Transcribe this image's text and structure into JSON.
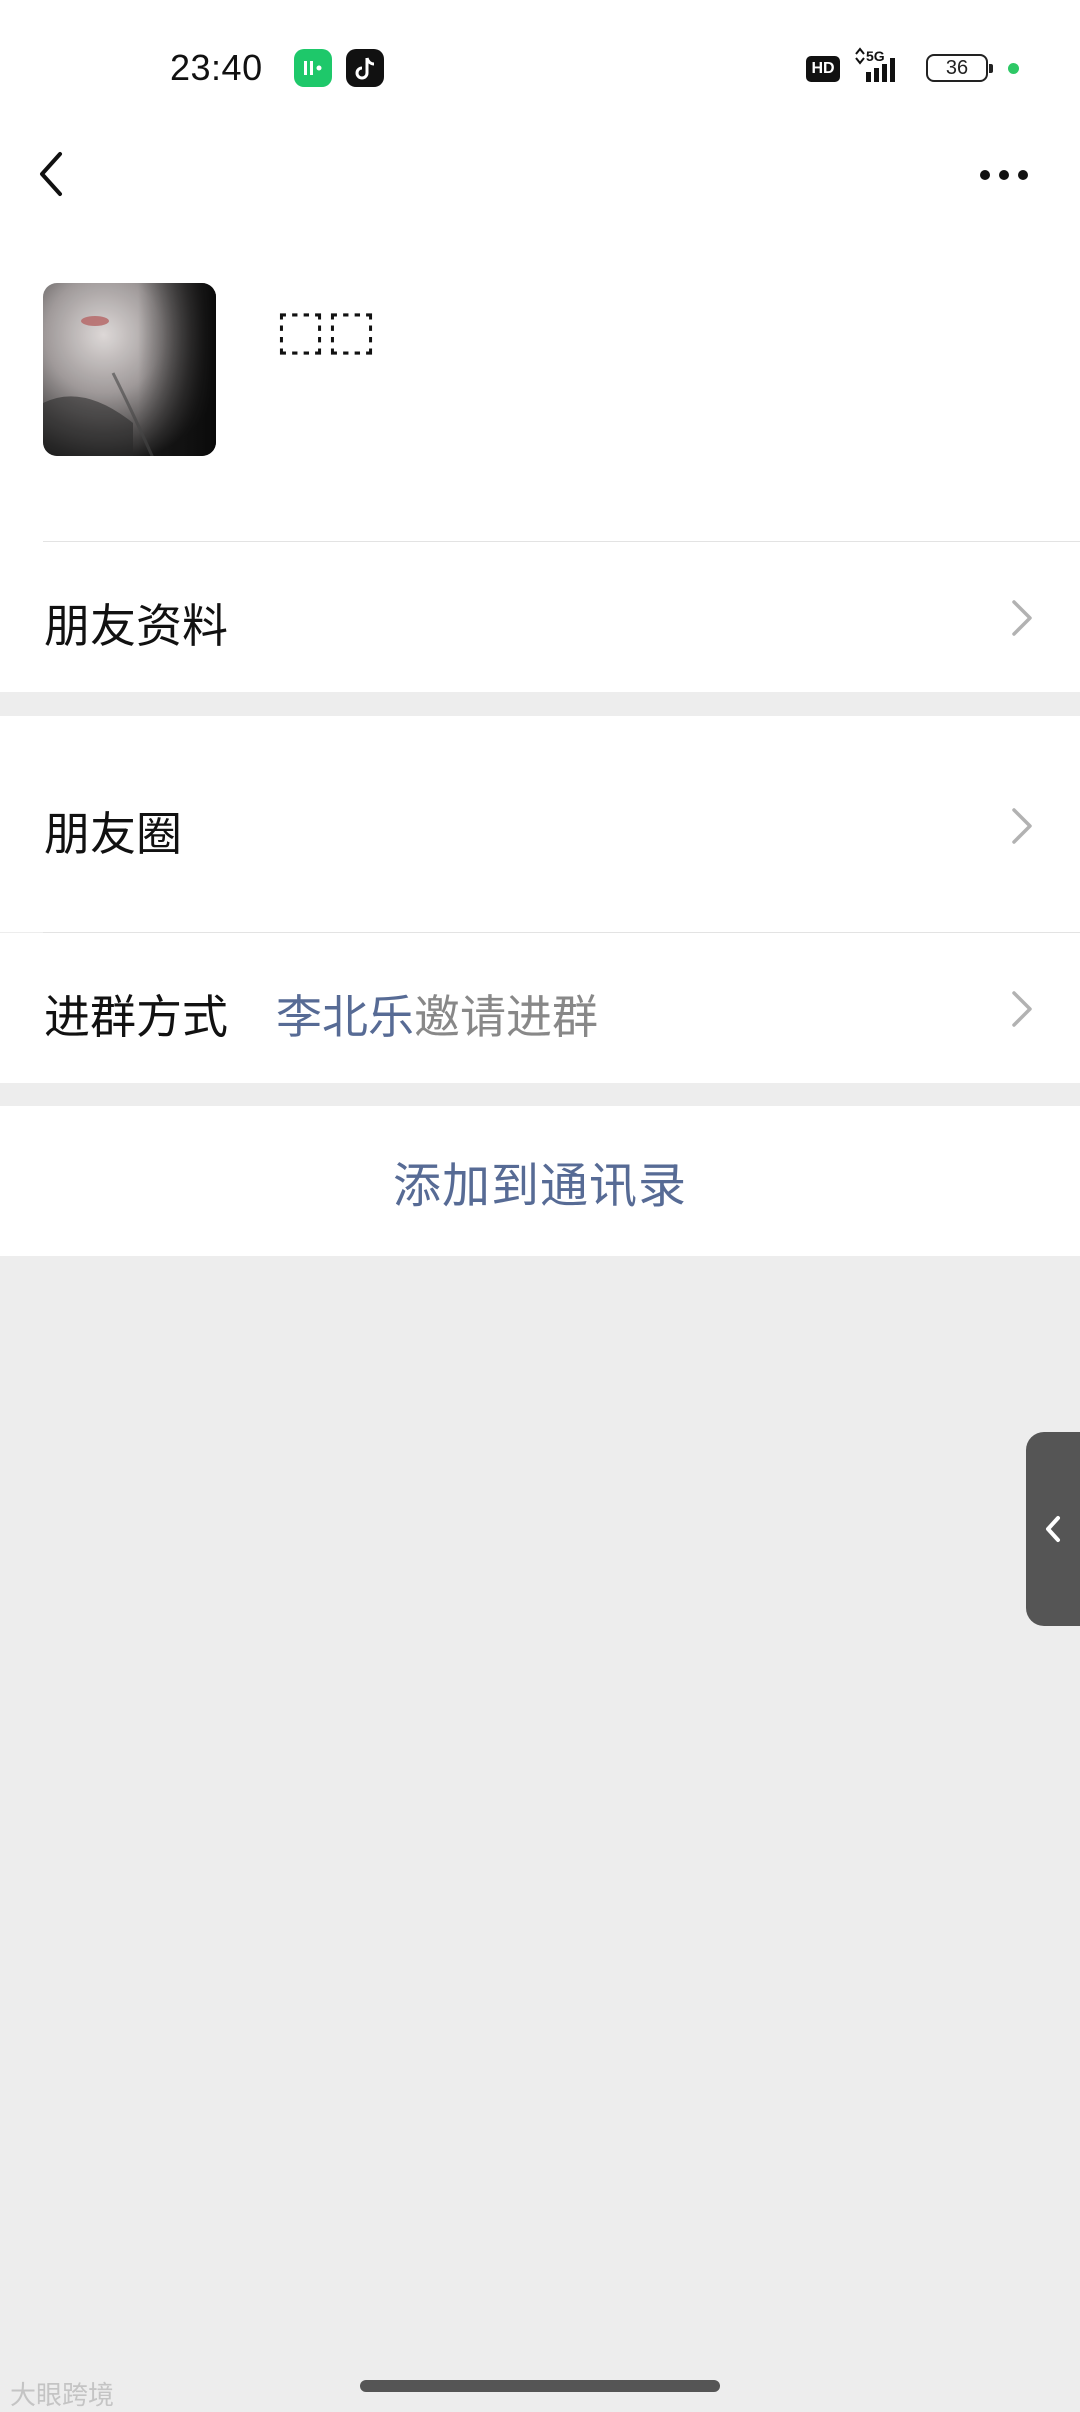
{
  "status_bar": {
    "time": "23:40",
    "network_badge": "HD",
    "network_type": "5G",
    "battery_level": "36"
  },
  "header": {
    "back_icon": "chevron-left-icon",
    "more_icon": "more-horizontal-icon"
  },
  "profile": {
    "name": "⬚⬚",
    "avatar_icon": "profile-photo"
  },
  "rows": {
    "friend_info": "朋友资料",
    "moments": "朋友圈",
    "join_method_label": "进群方式",
    "join_method_inviter": "李北乐",
    "join_method_suffix": "邀请进群"
  },
  "actions": {
    "add_to_contacts": "添加到通讯录"
  },
  "overlay": {
    "side_tab_icon": "chevron-left-icon"
  },
  "footer": {
    "watermark": "大眼跨境"
  },
  "colors": {
    "background": "#ededed",
    "card": "#ffffff",
    "link": "#576b95",
    "secondary_text": "#888888"
  }
}
